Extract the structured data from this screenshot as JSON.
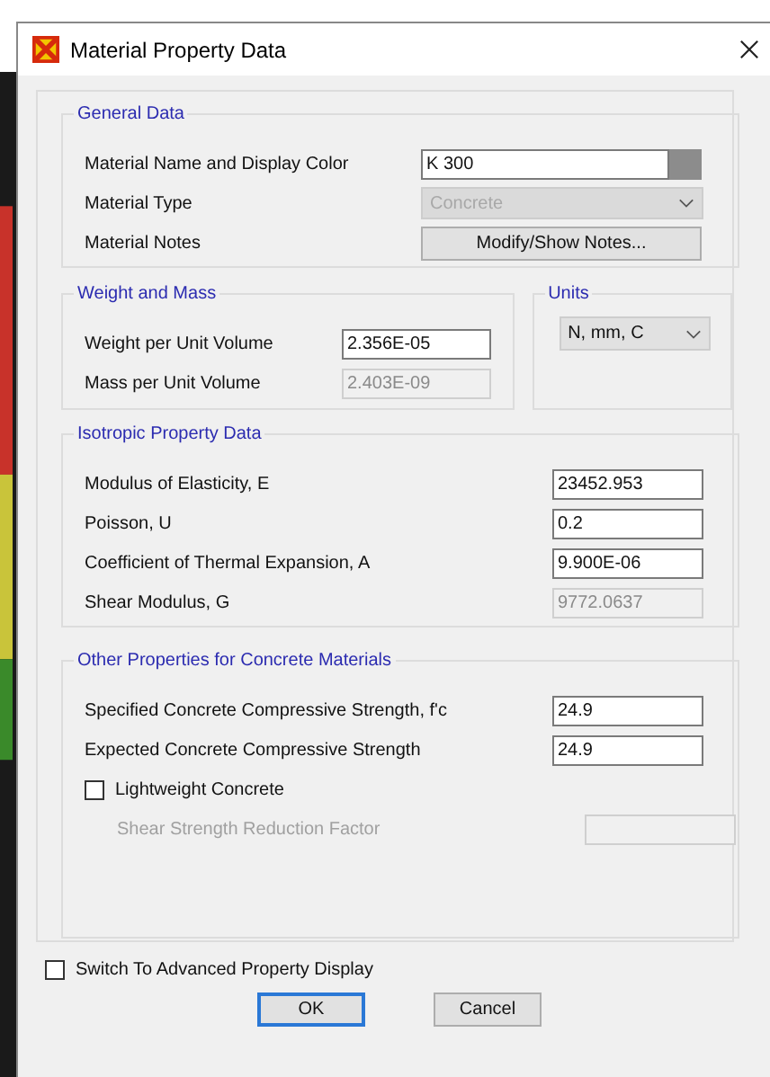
{
  "window": {
    "title": "Material Property Data"
  },
  "general_data": {
    "title": "General Data",
    "material_name": {
      "label": "Material Name and Display Color",
      "value": "K 300",
      "color": "#8c8c8c"
    },
    "material_type": {
      "label": "Material Type",
      "value": "Concrete",
      "disabled": true
    },
    "material_notes": {
      "label": "Material Notes",
      "button": "Modify/Show Notes..."
    }
  },
  "weight_and_mass": {
    "title": "Weight and Mass",
    "rows": [
      {
        "label": "Weight per Unit Volume",
        "value": "2.356E-05",
        "disabled": false
      },
      {
        "label": "Mass per Unit Volume",
        "value": "2.403E-09",
        "disabled": true
      }
    ]
  },
  "units": {
    "title": "Units",
    "value": "N, mm, C"
  },
  "isotropic": {
    "title": "Isotropic Property Data",
    "rows": [
      {
        "label": "Modulus of Elasticity,  E",
        "value": "23452.953",
        "disabled": false
      },
      {
        "label": "Poisson, U",
        "value": "0.2",
        "disabled": false
      },
      {
        "label": "Coefficient of Thermal Expansion,  A",
        "value": "9.900E-06",
        "disabled": false
      },
      {
        "label": "Shear Modulus,  G",
        "value": "9772.0637",
        "disabled": true
      }
    ]
  },
  "concrete": {
    "title": "Other Properties for Concrete Materials",
    "rows": [
      {
        "label": "Specified Concrete Compressive Strength, f'c",
        "value": "24.9",
        "disabled": false
      },
      {
        "label": "Expected Concrete Compressive Strength",
        "value": "24.9",
        "disabled": false
      }
    ],
    "lightweight": {
      "label": "Lightweight Concrete",
      "checked": false
    },
    "shear_factor": {
      "label": "Shear Strength Reduction Factor",
      "disabled": true
    }
  },
  "advanced": {
    "label": "Switch To Advanced Property Display",
    "checked": false
  },
  "buttons": [
    {
      "label": "OK",
      "default": true
    },
    {
      "label": "Cancel",
      "default": false
    }
  ]
}
